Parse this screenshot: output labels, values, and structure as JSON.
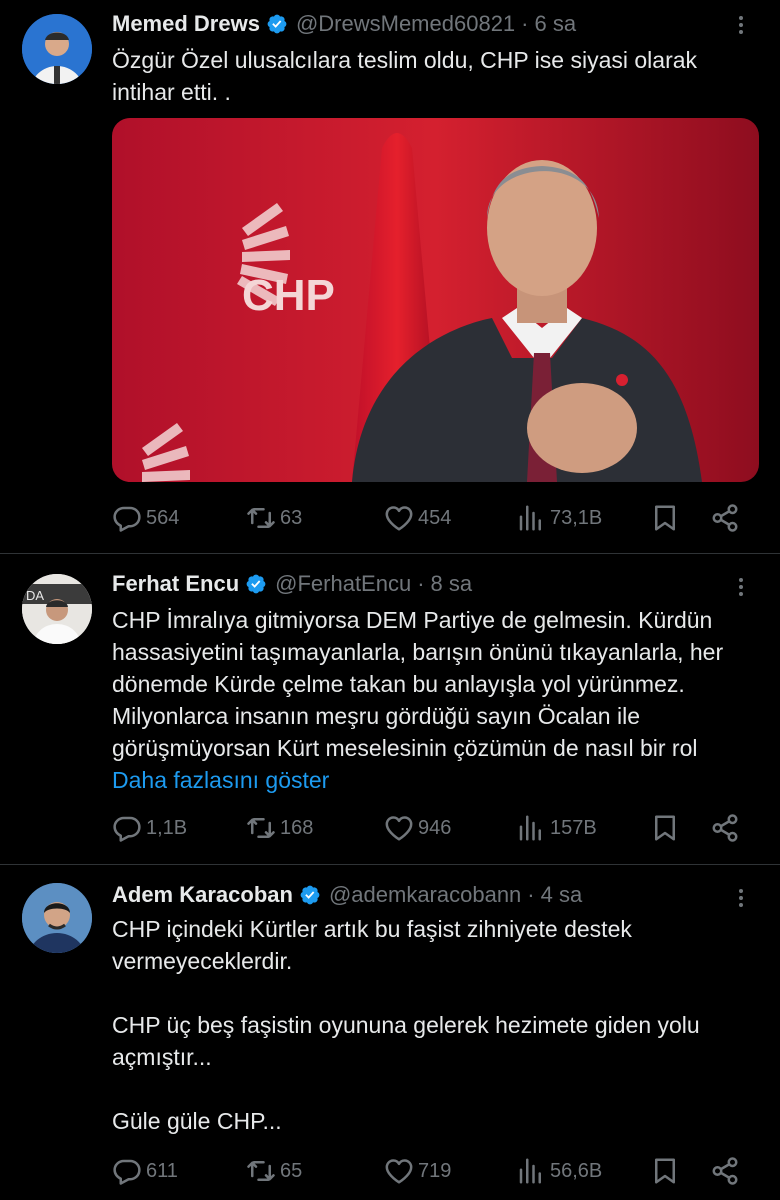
{
  "tweets": [
    {
      "name": "Memed Drews",
      "handle": "@DrewsMemed60821",
      "dot": "·",
      "time": "6 sa",
      "text": "Özgür Özel ulusalcılara teslim oldu, CHP ise siyasi olarak intihar etti. .",
      "media_logo_text": "CHP",
      "stats": {
        "replies": "564",
        "reposts": "63",
        "likes": "454",
        "views": "73,1B"
      }
    },
    {
      "name": "Ferhat Encu",
      "handle": "@FerhatEncu",
      "dot": "·",
      "time": "8 sa",
      "avatar_text": "DA",
      "text": "CHP İmralıya gitmiyorsa DEM Partiye de gelmesin. Kürdün hassasiyetini taşımayanlarla, barışın önünü tıkayanlarla, her dönemde Kürde çelme takan bu anlayışla yol yürünmez. Milyonlarca insanın meşru gördüğü sayın Öcalan ile görüşmüyorsan Kürt meselesinin çözümün de nasıl bir rol",
      "show_more": "Daha fazlasını göster",
      "stats": {
        "replies": "1,1B",
        "reposts": "168",
        "likes": "946",
        "views": "157B"
      }
    },
    {
      "name": "Adem Karacoban",
      "handle": "@ademkaracobann",
      "dot": "·",
      "time": "4 sa",
      "para1": "CHP içindeki Kürtler artık bu faşist zihniyete destek vermeyeceklerdir.",
      "para2": "CHP üç beş faşistin oyununa gelerek hezimete giden yolu açmıştır...",
      "para3": "Güle güle CHP...",
      "stats": {
        "replies": "611",
        "reposts": "65",
        "likes": "719",
        "views": "56,6B"
      }
    }
  ],
  "colors": {
    "background": "#000000",
    "text": "#e7e9ea",
    "muted": "#71767b",
    "link": "#1d9bf0",
    "verified": "#1d9bf0",
    "chp_red": "#c8102e"
  },
  "icons": [
    "verified-badge-icon",
    "more-icon",
    "reply-icon",
    "repost-icon",
    "like-icon",
    "views-icon",
    "bookmark-icon",
    "share-icon"
  ]
}
